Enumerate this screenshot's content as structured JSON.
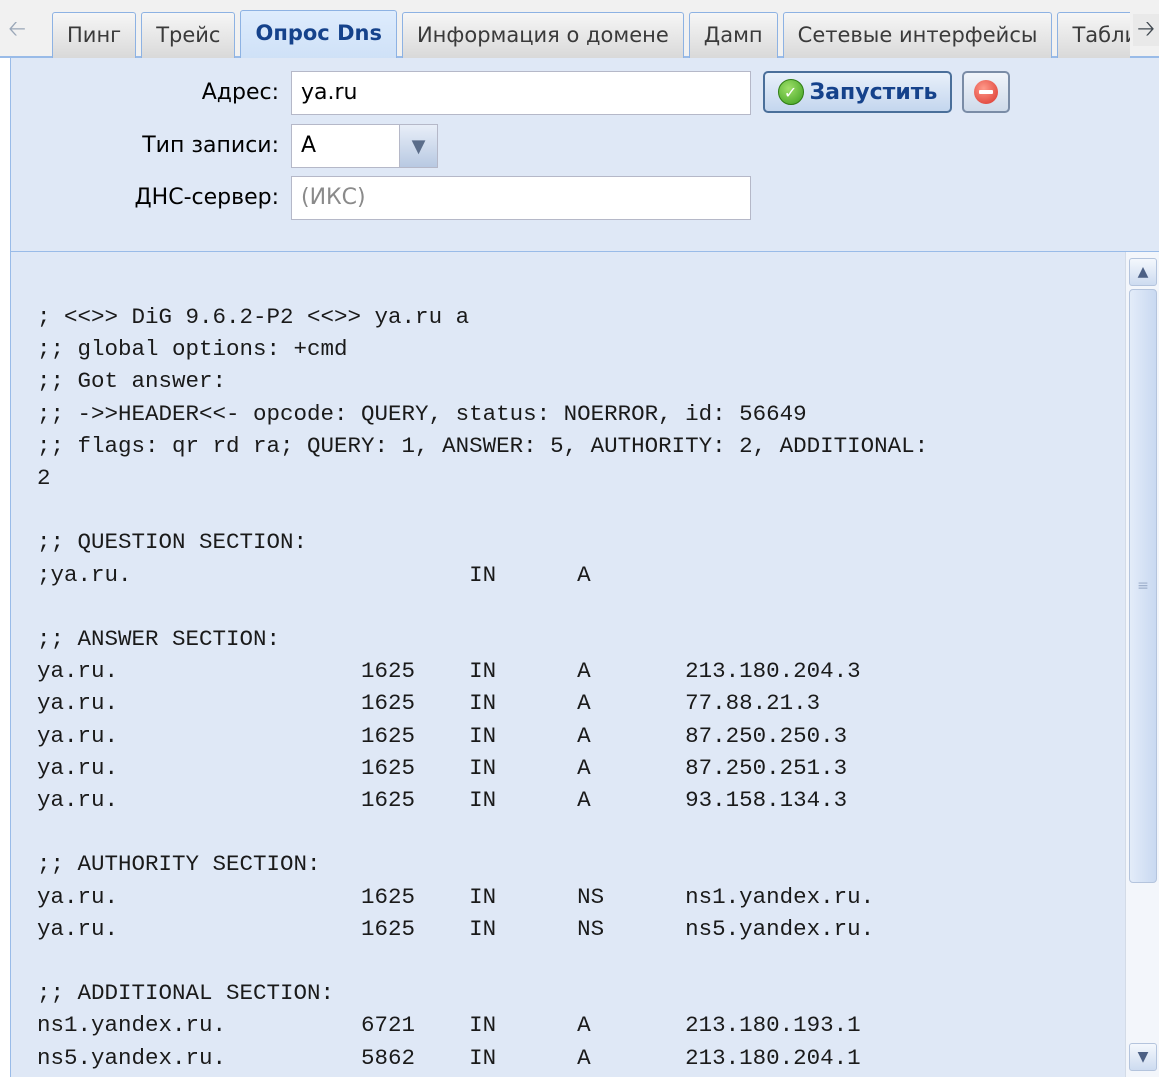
{
  "tabs": [
    {
      "label": "Пинг",
      "active": false
    },
    {
      "label": "Трейс",
      "active": false
    },
    {
      "label": "Опрос Dns",
      "active": true
    },
    {
      "label": "Информация о домене",
      "active": false
    },
    {
      "label": "Дамп",
      "active": false
    },
    {
      "label": "Сетевые интерфейсы",
      "active": false
    },
    {
      "label": "Таблица",
      "active": false
    }
  ],
  "form": {
    "address_label": "Адрес:",
    "address_value": "ya.ru",
    "record_type_label": "Тип записи:",
    "record_type_value": "A",
    "dns_server_label": "ДНС-сервер:",
    "dns_server_placeholder": "(ИКС)",
    "run_label": "Запустить"
  },
  "output": {
    "lines": [
      "; <<>> DiG 9.6.2-P2 <<>> ya.ru a",
      ";; global options: +cmd",
      ";; Got answer:",
      ";; ->>HEADER<<- opcode: QUERY, status: NOERROR, id: 56649",
      ";; flags: qr rd ra; QUERY: 1, ANSWER: 5, AUTHORITY: 2, ADDITIONAL:",
      "2",
      "",
      ";; QUESTION SECTION:",
      ";ya.ru.                         IN      A",
      "",
      ";; ANSWER SECTION:",
      "ya.ru.                  1625    IN      A       213.180.204.3",
      "ya.ru.                  1625    IN      A       77.88.21.3",
      "ya.ru.                  1625    IN      A       87.250.250.3",
      "ya.ru.                  1625    IN      A       87.250.251.3",
      "ya.ru.                  1625    IN      A       93.158.134.3",
      "",
      ";; AUTHORITY SECTION:",
      "ya.ru.                  1625    IN      NS      ns1.yandex.ru.",
      "ya.ru.                  1625    IN      NS      ns5.yandex.ru.",
      "",
      ";; ADDITIONAL SECTION:",
      "ns1.yandex.ru.          6721    IN      A       213.180.193.1",
      "ns5.yandex.ru.          5862    IN      A       213.180.204.1"
    ]
  },
  "icons": {
    "tab_scroll_left": "arrow-left-icon",
    "tab_scroll_right": "arrow-right-icon",
    "run": "check-circle-icon",
    "stop": "minus-circle-icon",
    "combo": "chevron-down-icon",
    "scroll_up": "chevron-up-icon",
    "scroll_down": "chevron-down-icon",
    "scroll_grip": "grip-icon"
  },
  "colors": {
    "panel_bg": "#dfe8f6",
    "active_tab_text": "#15428b",
    "border": "#99bbe8"
  }
}
